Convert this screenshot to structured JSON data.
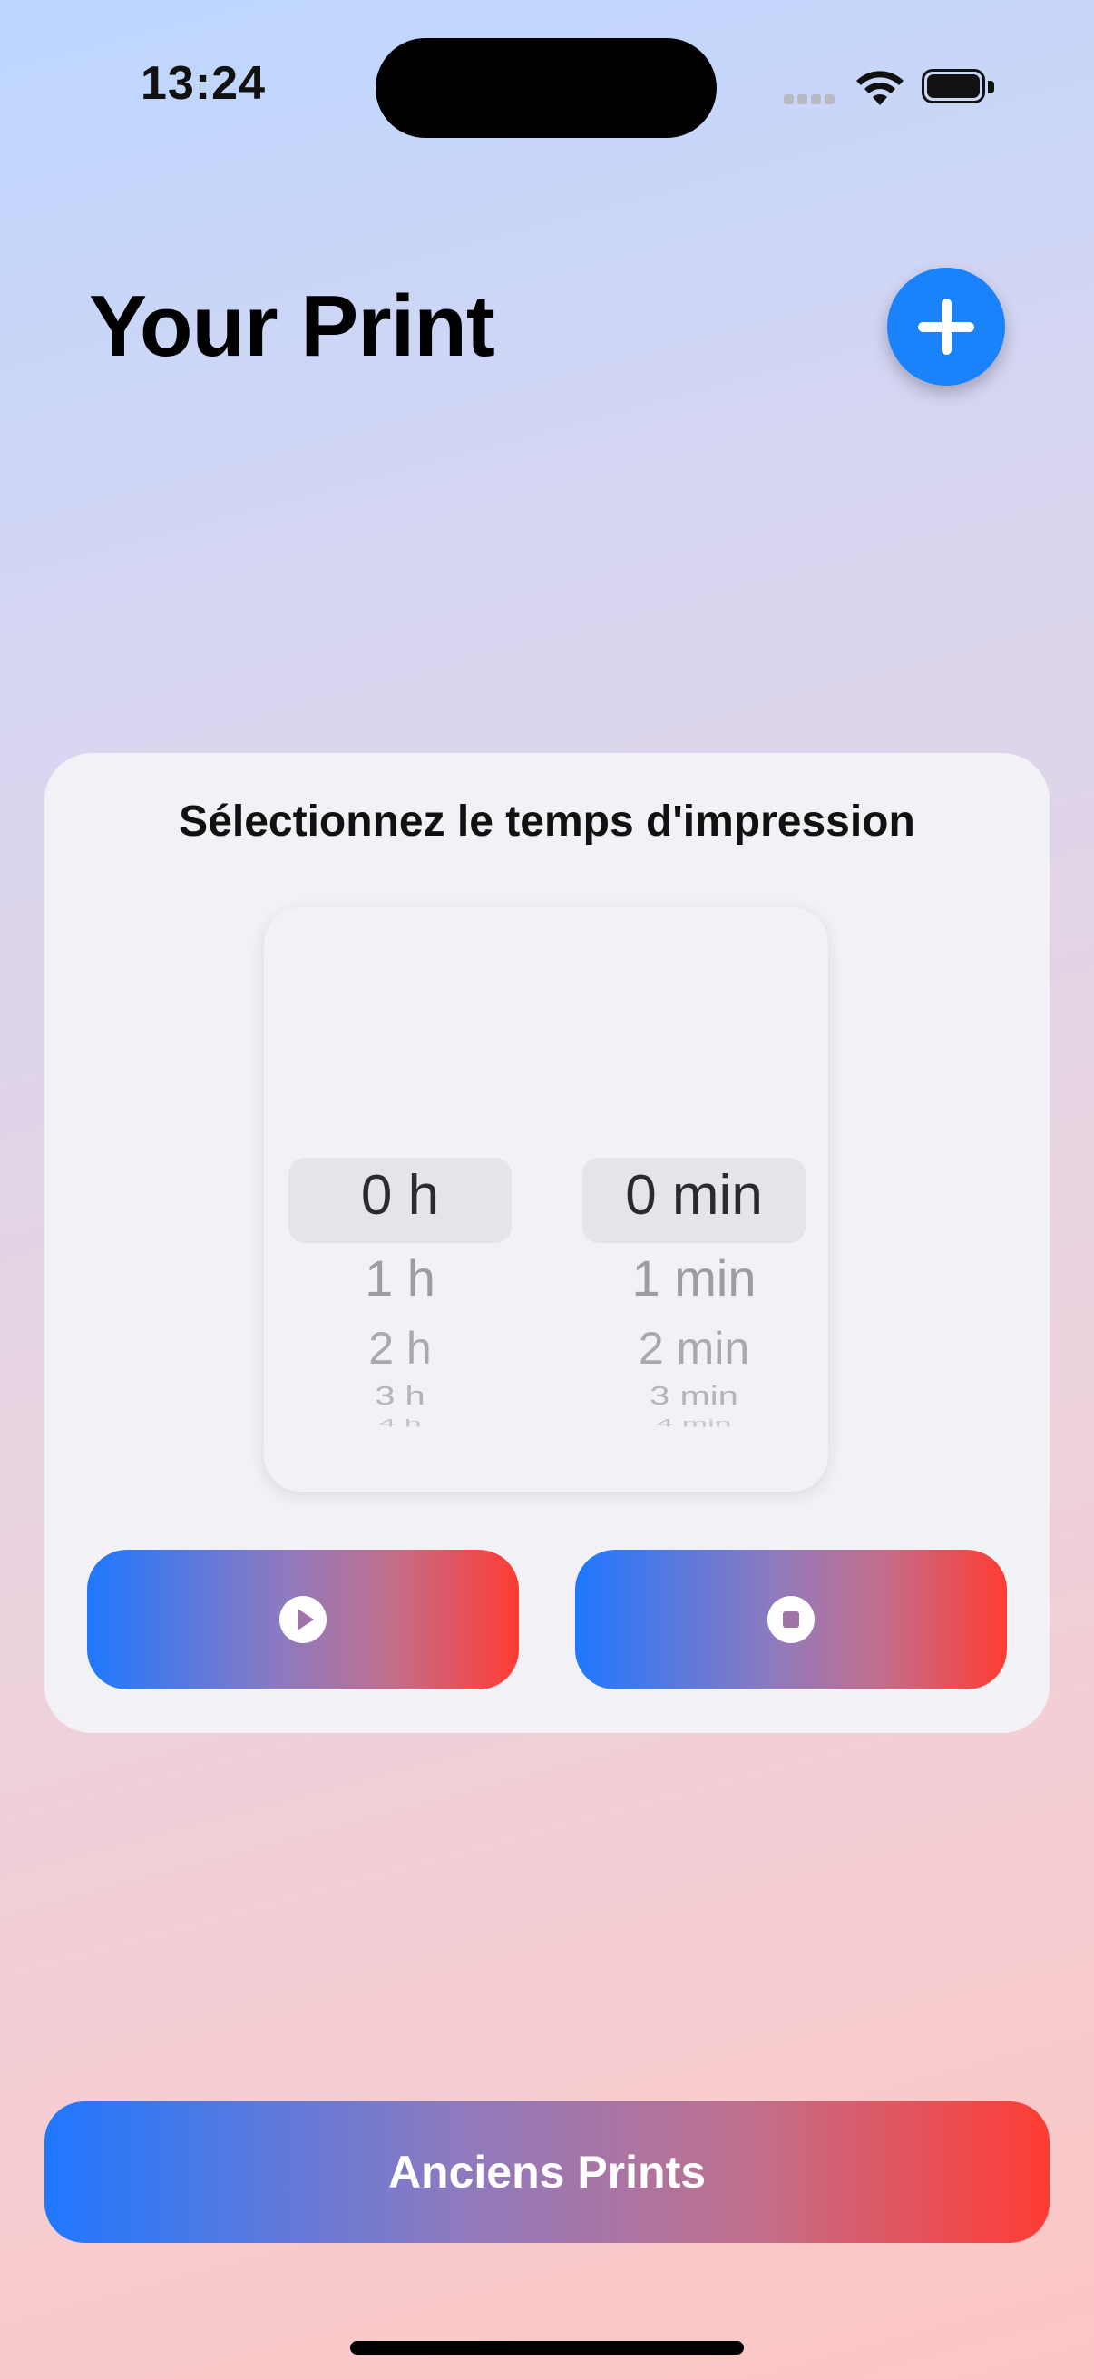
{
  "status_bar": {
    "time": "13:24",
    "icons": [
      "signal-icon",
      "wifi-icon",
      "battery-icon"
    ]
  },
  "header": {
    "title": "Your Print",
    "add_icon": "plus-icon"
  },
  "card": {
    "title": "Sélectionnez le temps d'impression",
    "picker": {
      "hours": {
        "selected": "0 h",
        "options": [
          "0 h",
          "1 h",
          "2 h",
          "3 h",
          "4 h"
        ]
      },
      "minutes": {
        "selected": "0 min",
        "options": [
          "0 min",
          "1 min",
          "2 min",
          "3 min",
          "4 min"
        ]
      }
    },
    "play_icon": "play-icon",
    "stop_icon": "stop-icon"
  },
  "footer": {
    "history_button_label": "Anciens Prints"
  },
  "colors": {
    "accent_blue": "#1a82fb",
    "gradient_start": "#1f78ff",
    "gradient_end": "#ff3c33"
  }
}
